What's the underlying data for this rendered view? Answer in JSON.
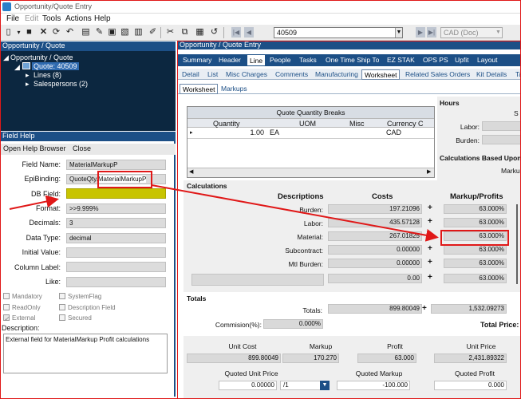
{
  "window": {
    "title": "Opportunity/Quote Entry"
  },
  "menu": [
    "File",
    "Edit",
    "Tools",
    "Actions",
    "Help"
  ],
  "toolbar": {
    "key_value": "40509",
    "currency_value": "CAD (Doc)"
  },
  "tree_panel": {
    "title": "Opportunity / Quote",
    "root": "Opportunity / Quote",
    "quote": "Quote: 40509",
    "lines": "Lines (8)",
    "salespersons": "Salespersons (2)"
  },
  "field_help": {
    "title": "Field Help",
    "open_help_browser": "Open Help Browser",
    "close": "Close",
    "labels": {
      "field_name": "Field Name:",
      "epi_binding": "EpiBinding:",
      "db_field": "DB Field:",
      "format": "Format:",
      "decimals": "Decimals:",
      "data_type": "Data Type:",
      "initial_value": "Initial Value:",
      "column_label": "Column Label:",
      "like": "Like:",
      "description": "Description:"
    },
    "values": {
      "field_name": "MaterialMarkupP",
      "epi_binding_prefix": "QuoteQty.",
      "epi_binding_field": "MaterialMarkupP",
      "db_field": "",
      "format": ">>9.999%",
      "decimals": "3",
      "data_type": "decimal",
      "initial_value": "",
      "column_label": "",
      "like": ""
    },
    "checkboxes": {
      "mandatory": "Mandatory",
      "readonly": "ReadOnly",
      "external": "External",
      "system_flag": "SystemFlag",
      "description_field": "Description Field",
      "secured": "Secured"
    },
    "description_text": "External field for MaterialMarkup Profit calculations"
  },
  "main_panel": {
    "title": "Opportunity / Quote Entry",
    "tabs": [
      "Summary",
      "Header",
      "Line",
      "People",
      "Tasks",
      "One Time Ship To",
      "EZ STAK",
      "OPS PS",
      "Upfit",
      "Layout"
    ],
    "subtabs": [
      "Detail",
      "List",
      "Misc Charges",
      "Comments",
      "Manufacturing",
      "Worksheet",
      "Related Sales Orders",
      "Kit Details",
      "Tax"
    ],
    "subsubtabs": [
      "Worksheet",
      "Markups"
    ],
    "qty_breaks": {
      "title": "Quote Quantity Breaks",
      "columns": [
        "Quantity",
        "UOM",
        "Misc",
        "Currency C"
      ],
      "row": [
        "1.00",
        "EA",
        "",
        "CAD"
      ]
    },
    "hours": {
      "title": "Hours",
      "s_label": "S",
      "labor": "Labor:",
      "burden": "Burden:"
    },
    "calc_based": {
      "title": "Calculations Based Upon",
      "markup": "Marku"
    },
    "calculations": {
      "title": "Calculations",
      "col_desc": "Descriptions",
      "col_costs": "Costs",
      "col_markup": "Markup/Profits",
      "rows": [
        {
          "label": "Burden:",
          "cost": "197.21096",
          "markup": "63.000%"
        },
        {
          "label": "Labor:",
          "cost": "435.57128",
          "markup": "63.000%"
        },
        {
          "label": "Material:",
          "cost": "267.01825",
          "markup": "63.000%"
        },
        {
          "label": "Subcontract:",
          "cost": "0.00000",
          "markup": "63.000%"
        },
        {
          "label": "Mtl Burden:",
          "cost": "0.00000",
          "markup": "63.000%"
        },
        {
          "label": "",
          "cost": "0.00",
          "markup": "63.000%"
        }
      ]
    },
    "totals": {
      "title": "Totals",
      "totals_label": "Totals:",
      "total_cost": "899.80049",
      "total_markup": "1,532.09273",
      "commission_label": "Commision(%):",
      "commission": "0.000%",
      "total_price_label": "Total Price:"
    },
    "pricing": {
      "unit_cost_label": "Unit Cost",
      "markup_label": "Markup",
      "profit_label": "Profit",
      "unit_price_label": "Unit Price",
      "unit_cost": "899.80049",
      "markup": "170.270",
      "profit": "63.000",
      "unit_price": "2,431.89322",
      "quoted_unit_price_label": "Quoted Unit Price",
      "quoted_markup_label": "Quoted Markup",
      "quoted_profit_label": "Quoted Profit",
      "quoted_unit_price": "0.00000",
      "per_value": "/1",
      "quoted_markup": "-100.000",
      "quoted_profit": "0.000"
    }
  },
  "colors": {
    "accent": "#1c4f86",
    "highlight": "#c8c400",
    "annotation": "#e01818"
  }
}
